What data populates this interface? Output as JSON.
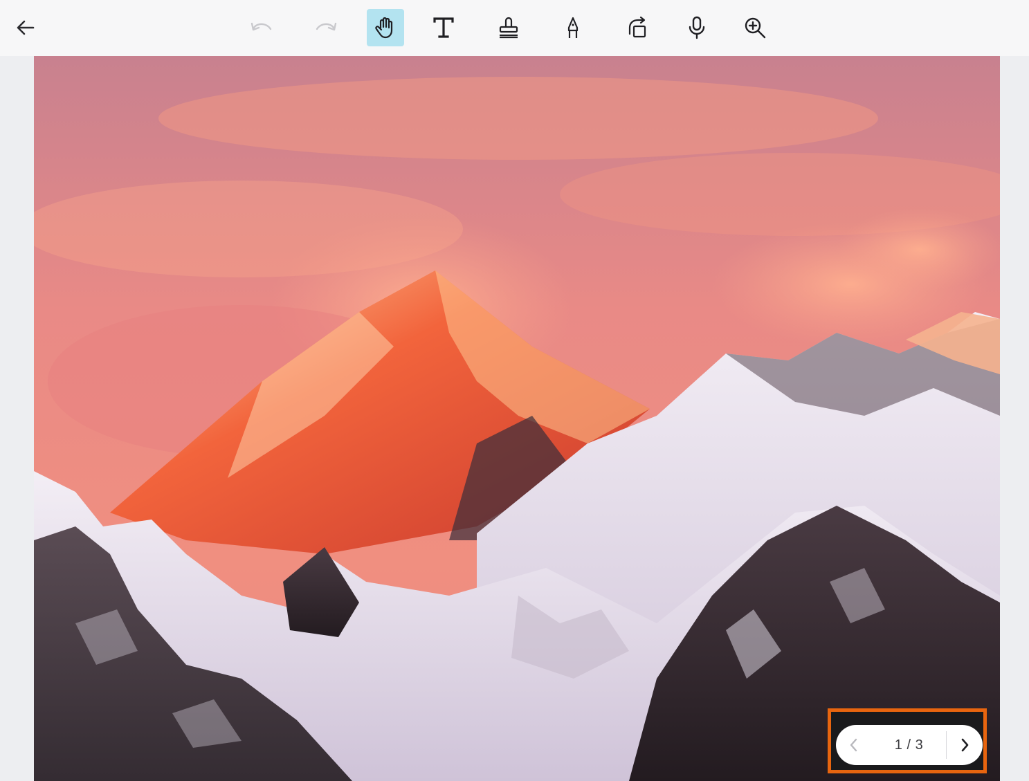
{
  "toolbar": {
    "back": {
      "icon": "back-arrow-icon"
    },
    "tools": [
      {
        "id": "undo",
        "icon": "undo-icon",
        "enabled": false
      },
      {
        "id": "redo",
        "icon": "redo-icon",
        "enabled": false
      },
      {
        "id": "pan",
        "icon": "hand-icon",
        "active": true
      },
      {
        "id": "text",
        "icon": "text-icon"
      },
      {
        "id": "stamp",
        "icon": "stamp-icon"
      },
      {
        "id": "pen",
        "icon": "pen-icon"
      },
      {
        "id": "rotate",
        "icon": "rotate-icon"
      },
      {
        "id": "voice",
        "icon": "microphone-icon"
      },
      {
        "id": "zoom",
        "icon": "zoom-in-icon"
      }
    ],
    "active_color": "#b3e3f0"
  },
  "photo": {
    "subject": "mountain-photo"
  },
  "pager": {
    "label": "1 / 3",
    "current": 1,
    "total": 3,
    "highlight_color": "#e8650f"
  }
}
